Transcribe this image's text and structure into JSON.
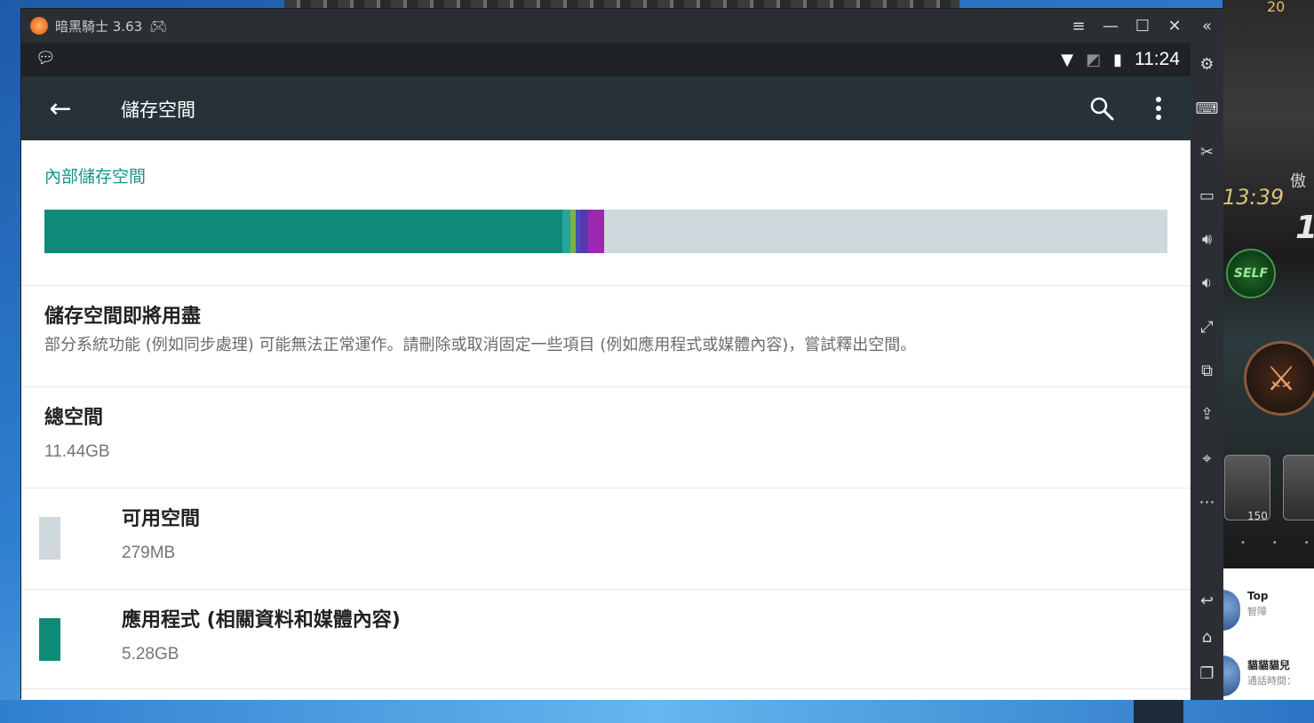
{
  "window": {
    "title": "暗黑騎士 3.63",
    "controls": {
      "menu": "menu-icon",
      "minimize": "minimize-icon",
      "maximize": "maximize-icon",
      "close": "close-icon"
    }
  },
  "status_bar": {
    "time": "11:24"
  },
  "app_bar": {
    "title": "儲存空間"
  },
  "storage": {
    "section_header": "內部儲存空間",
    "usage_bar": {
      "total_fraction_used": 0.498,
      "segments": [
        {
          "name": "apps",
          "color": "#0f8a78",
          "fraction": 0.461
        },
        {
          "name": "seg2",
          "color": "#26a69a",
          "fraction": 0.007
        },
        {
          "name": "seg3",
          "color": "#7cb342",
          "fraction": 0.005
        },
        {
          "name": "seg4",
          "color": "#3f51b5",
          "fraction": 0.004
        },
        {
          "name": "seg5",
          "color": "#5e35b1",
          "fraction": 0.007
        },
        {
          "name": "seg6",
          "color": "#9c27b0",
          "fraction": 0.014
        }
      ],
      "empty_color": "#cfd8dc"
    },
    "warning": {
      "title": "儲存空間即將用盡",
      "body": "部分系統功能 (例如同步處理) 可能無法正常運作。請刪除或取消固定一些項目 (例如應用程式或媒體內容)，嘗試釋出空間。"
    },
    "total": {
      "label": "總空間",
      "value": "11.44GB"
    },
    "items": [
      {
        "label": "可用空間",
        "value": "279MB",
        "color": "#cfd8dc"
      },
      {
        "label": "應用程式 (相關資料和媒體內容)",
        "value": "5.28GB",
        "color": "#0f8a78"
      }
    ]
  },
  "side_toolbar": {
    "buttons": [
      "collapse",
      "settings",
      "keyboard",
      "screenshot",
      "record",
      "volume-up",
      "volume-down",
      "fullscreen",
      "multi-instance",
      "install-apk",
      "location",
      "more",
      "back",
      "home",
      "recents"
    ]
  },
  "game": {
    "timer": "13:39",
    "self_label": "SELF",
    "text_a": "傲",
    "text_b": "1",
    "text_c": "20",
    "skill_num": "150"
  },
  "chat": {
    "items": [
      {
        "name": "Top",
        "sub": "智障"
      },
      {
        "name": "貓貓貓兒",
        "sub": "通話時間："
      }
    ]
  }
}
